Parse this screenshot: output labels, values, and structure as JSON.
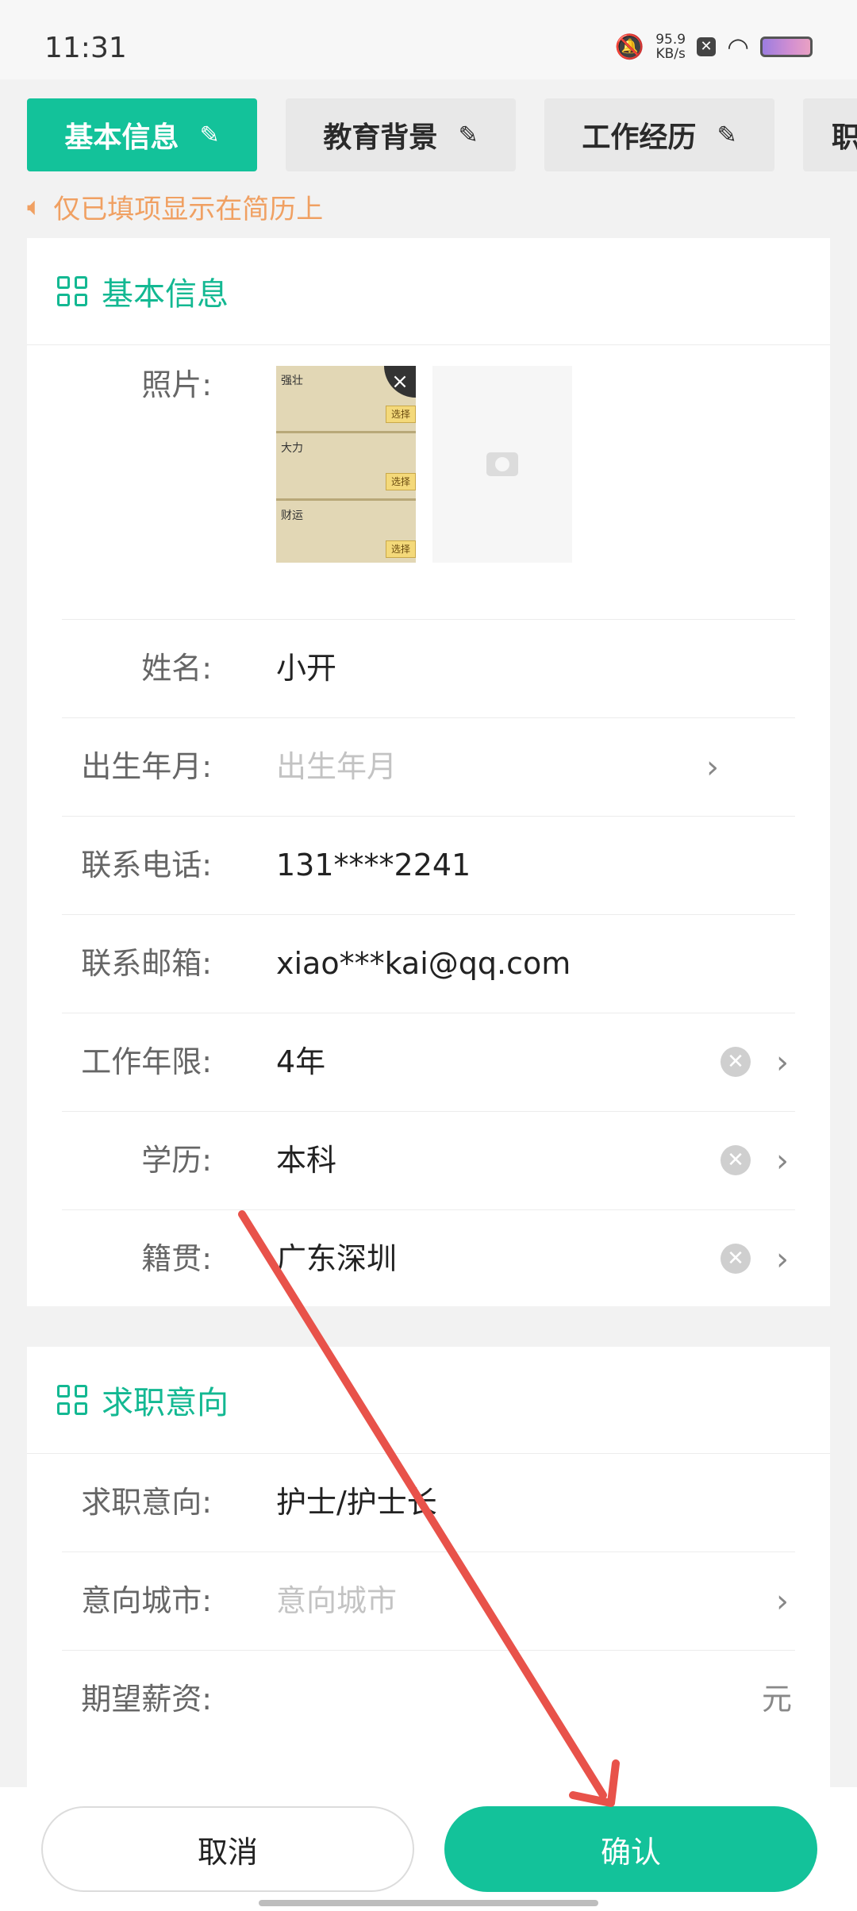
{
  "status": {
    "time": "11:31",
    "speed_value": "95.9",
    "speed_unit": "KB/s"
  },
  "tabs": [
    {
      "label": "基本信息"
    },
    {
      "label": "教育背景"
    },
    {
      "label": "工作经历"
    },
    {
      "label": "职"
    }
  ],
  "notice": "仅已填项显示在简历上",
  "basic": {
    "title": "基本信息",
    "photo_label": "照片:",
    "thumb_strips": [
      {
        "title": "强壮",
        "btn": "选择"
      },
      {
        "title": "大力",
        "btn": "选择"
      },
      {
        "title": "财运",
        "btn": "选择"
      }
    ],
    "name": {
      "label": "姓名:",
      "value": "小开"
    },
    "birth": {
      "label": "出生年月:",
      "placeholder": "出生年月"
    },
    "phone": {
      "label": "联系电话:",
      "value": "131****2241"
    },
    "email": {
      "label": "联系邮箱:",
      "value": "xiao***kai@qq.com"
    },
    "years": {
      "label": "工作年限:",
      "value": "4年"
    },
    "education": {
      "label": "学历:",
      "value": "本科"
    },
    "hometown": {
      "label": "籍贯:",
      "value": "广东深圳"
    }
  },
  "intent": {
    "title": "求职意向",
    "job": {
      "label": "求职意向:",
      "value": "护士/护士长"
    },
    "city": {
      "label": "意向城市:",
      "placeholder": "意向城市"
    },
    "salary": {
      "label": "期望薪资:",
      "unit": "元"
    }
  },
  "buttons": {
    "cancel": "取消",
    "confirm": "确认"
  },
  "colors": {
    "accent": "#13c29a",
    "notice": "#f0a062",
    "annotation_arrow": "#e8524a"
  }
}
